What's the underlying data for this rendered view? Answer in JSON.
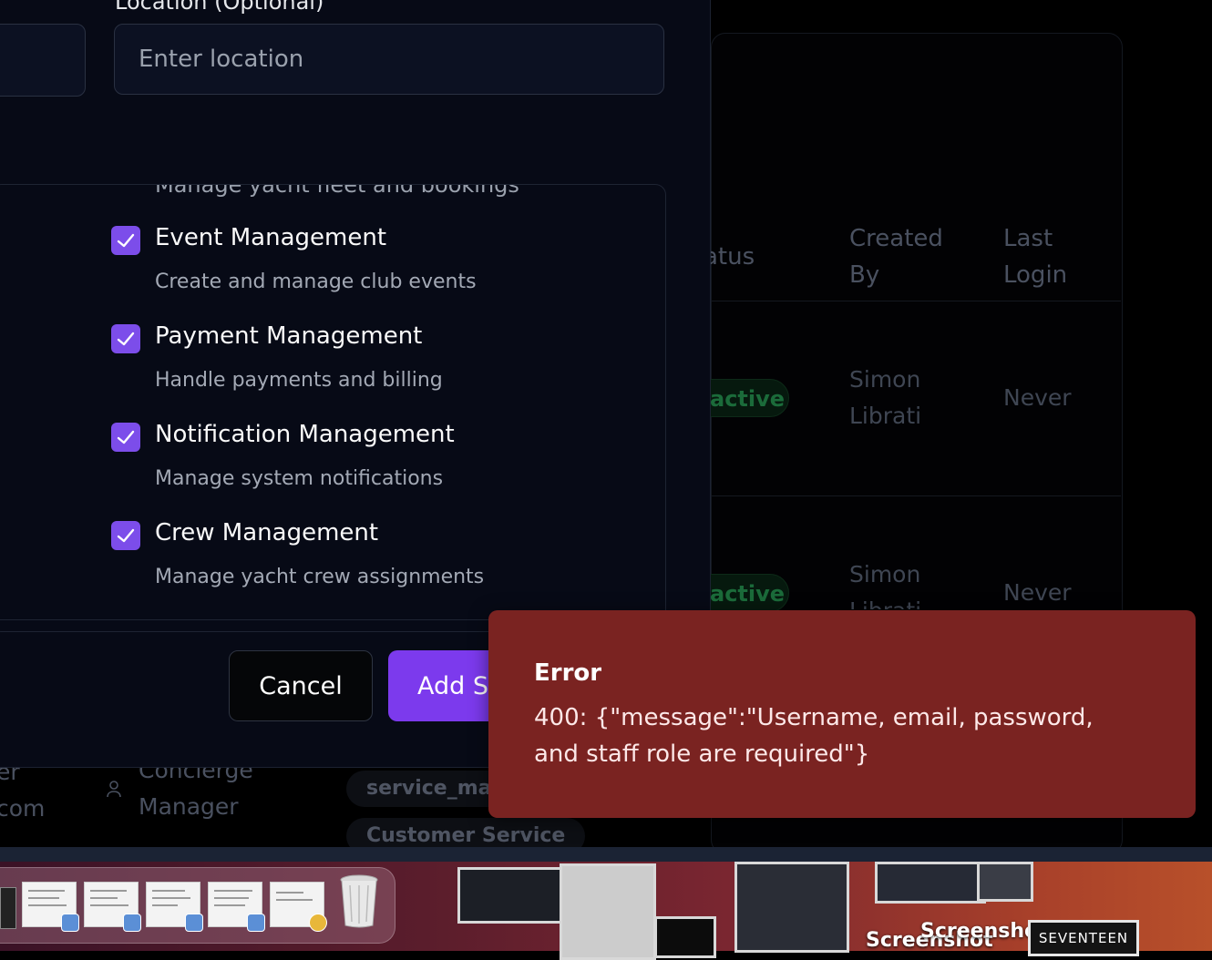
{
  "modal": {
    "location_label": "Location (Optional)",
    "location_placeholder": "Enter location",
    "clipped_text": "Manage yacht fleet and bookings",
    "permissions": [
      {
        "title": "Event Management",
        "description": "Create and manage club events",
        "checked": true
      },
      {
        "title": "Payment Management",
        "description": "Handle payments and billing",
        "checked": true
      },
      {
        "title": "Notification Management",
        "description": "Manage system notifications",
        "checked": true
      },
      {
        "title": "Crew Management",
        "description": "Manage yacht crew assignments",
        "checked": true
      }
    ],
    "cancel_label": "Cancel",
    "add_label": "Add Staff Member"
  },
  "table": {
    "headers": {
      "status": "Status",
      "created_by": "Created By",
      "last_login": "Last Login"
    },
    "rows": [
      {
        "status": "active",
        "created_by": "Simon Librati",
        "last_login": "Never"
      },
      {
        "status": "active",
        "created_by": "Simon Librati",
        "last_login": "Never"
      }
    ],
    "under_rows": {
      "email_fragment": "er\ncom",
      "role": "Concierge Manager",
      "chips": [
        "service_manager",
        "Customer Service"
      ]
    }
  },
  "toast": {
    "title": "Error",
    "message": "400: {\"message\":\"Username, email, password, and staff role are required\"}"
  },
  "desktop": {
    "labels": [
      "Screenshot",
      "Screenshot",
      "SEVENTEEN"
    ]
  },
  "colors": {
    "accent": "#7c3aed",
    "checkbox": "#7c4dea",
    "toast_bg": "#7a2321",
    "badge_green": "#1b6b3a"
  }
}
